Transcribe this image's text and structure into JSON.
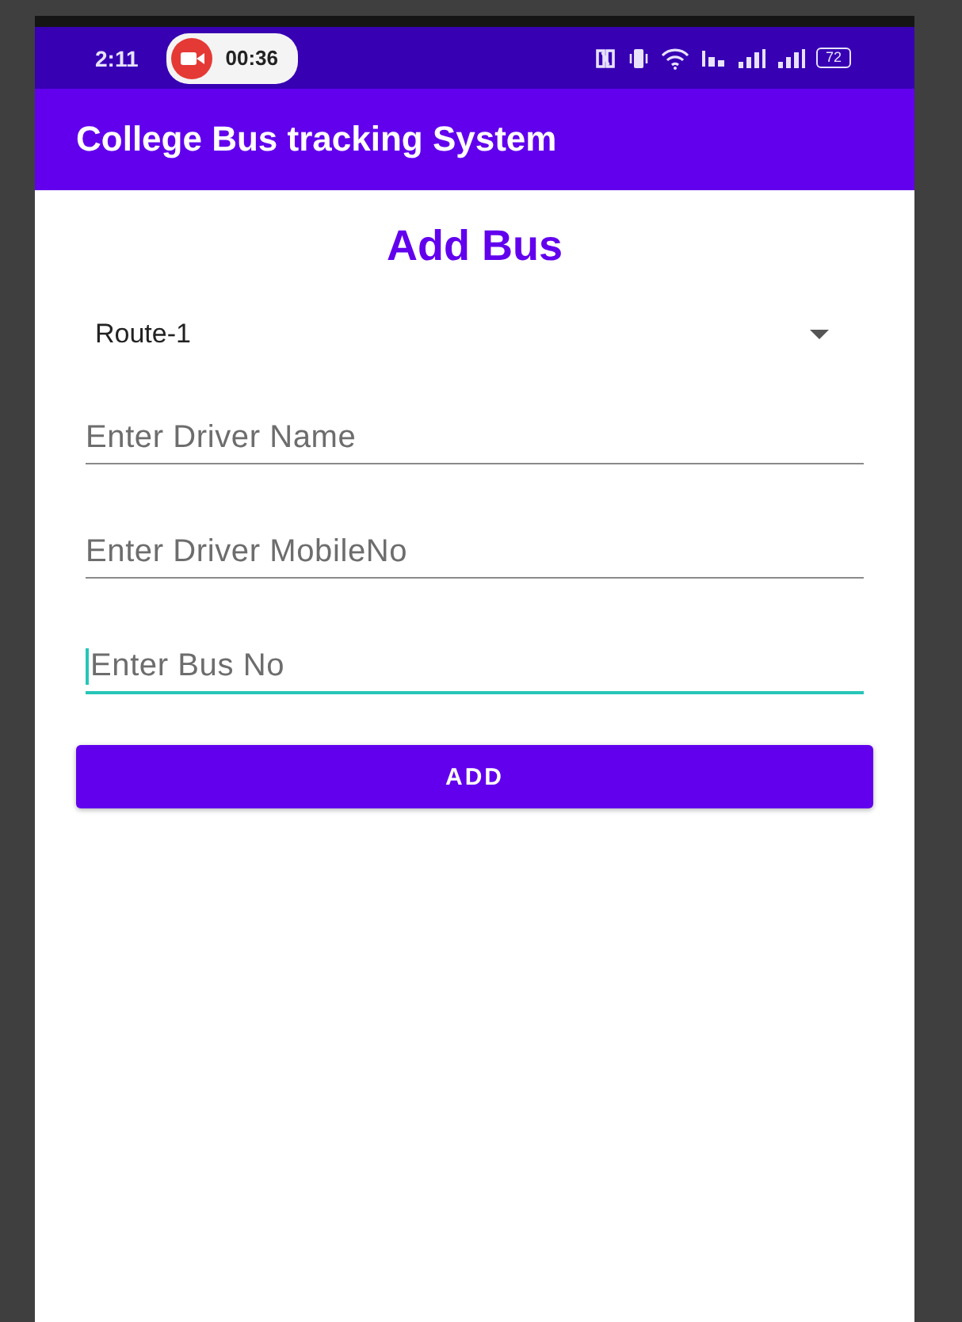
{
  "status_bar": {
    "time": "2:11",
    "recording": {
      "timer": "00:36"
    },
    "battery": "72"
  },
  "app_bar": {
    "title": "College Bus tracking System"
  },
  "heading": "Add Bus",
  "route_dropdown": {
    "value": "Route-1"
  },
  "fields": [
    {
      "placeholder": "Enter Driver Name",
      "focused": false
    },
    {
      "placeholder": "Enter Driver MobileNo",
      "focused": false
    },
    {
      "placeholder": "Enter Bus No",
      "focused": true
    }
  ],
  "buttons": [
    "ADD"
  ]
}
